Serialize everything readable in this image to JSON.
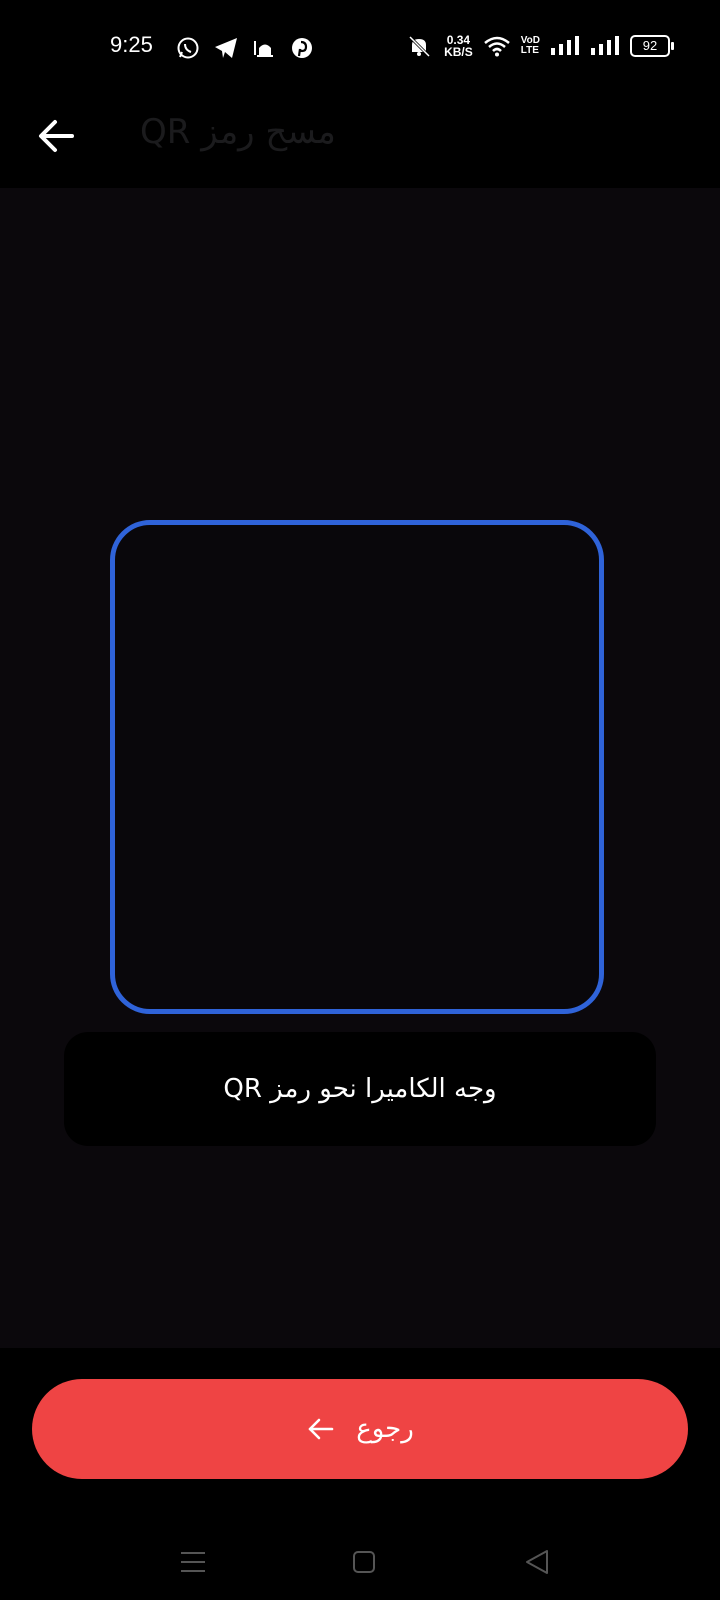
{
  "status_bar": {
    "time": "9:25",
    "net_speed_value": "0.34",
    "net_speed_unit": "KB/S",
    "volte_top": "VoD",
    "volte_bottom": "LTE",
    "battery": "92",
    "icons": [
      "whatsapp-icon",
      "telegram-icon",
      "mosque-icon",
      "pinterest-icon",
      "mute-icon",
      "wifi-icon",
      "signal-icon",
      "signal-icon"
    ]
  },
  "app_bar": {
    "title": "مسح رمز QR",
    "back_icon": "arrow-left-icon"
  },
  "scanner": {
    "frame_color": "#2f63d9",
    "hint": "وجه الكاميرا نحو رمز QR"
  },
  "footer": {
    "back_label": "رجوع",
    "back_icon": "arrow-left-icon",
    "button_color": "#ef4444"
  },
  "nav": {
    "icons": [
      "menu-icon",
      "home-icon",
      "back-triangle-icon"
    ]
  }
}
